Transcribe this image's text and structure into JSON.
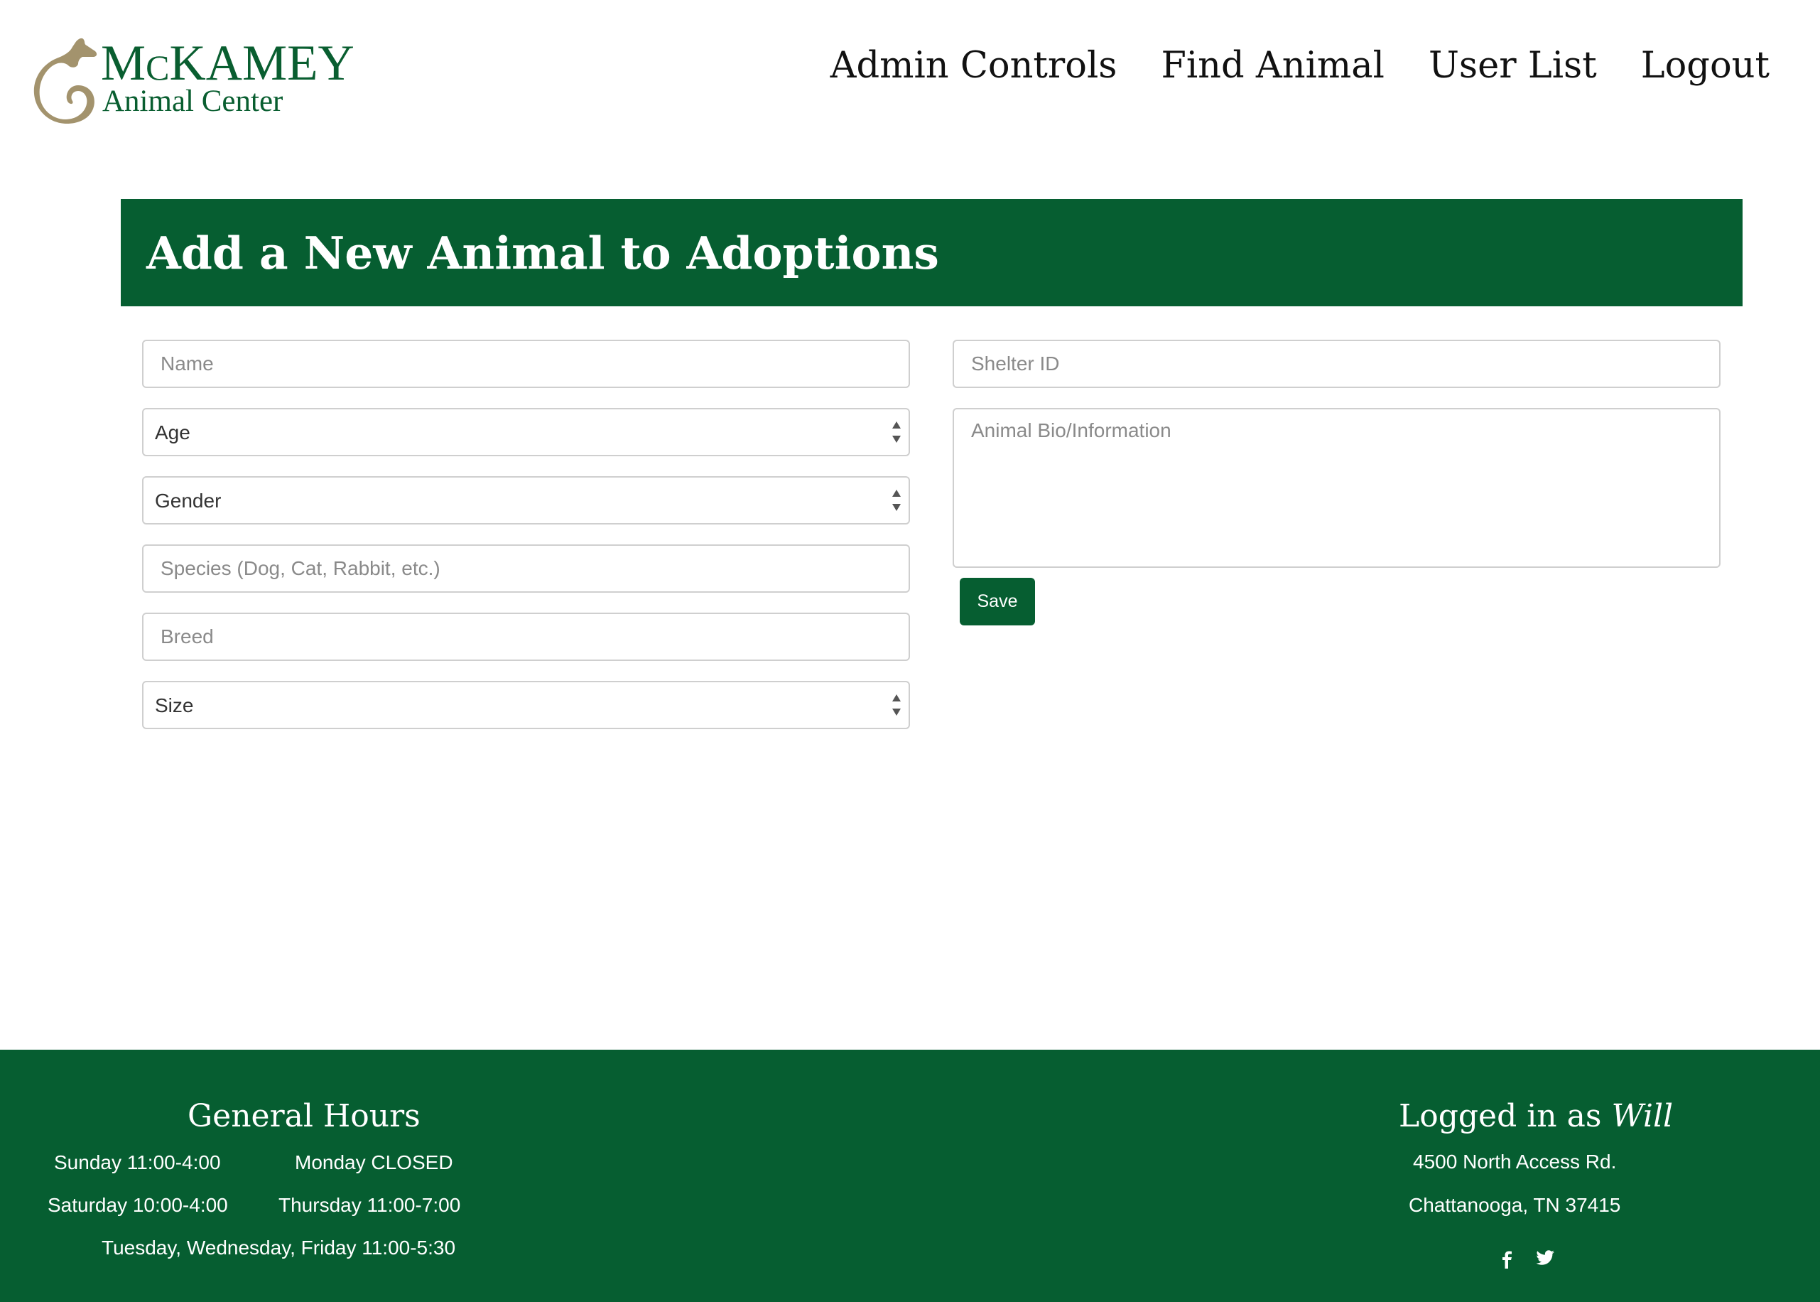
{
  "header": {
    "logo": {
      "title_initial": "M",
      "title_small": "c",
      "title_rest": "KAMEY",
      "subtitle": "Animal Center"
    },
    "nav": [
      {
        "label": "Admin Controls"
      },
      {
        "label": "Find Animal"
      },
      {
        "label": "User List"
      },
      {
        "label": "Logout"
      }
    ]
  },
  "page": {
    "title": "Add a New Animal to Adoptions"
  },
  "form": {
    "name": {
      "placeholder": "Name"
    },
    "age": {
      "selected": "Age"
    },
    "gender": {
      "selected": "Gender"
    },
    "species": {
      "placeholder": "Species (Dog, Cat, Rabbit, etc.)"
    },
    "breed": {
      "placeholder": "Breed"
    },
    "size": {
      "selected": "Size"
    },
    "shelter_id": {
      "placeholder": "Shelter ID"
    },
    "bio": {
      "placeholder": "Animal Bio/Information"
    },
    "save_label": "Save"
  },
  "footer": {
    "hours_title": "General Hours",
    "hours": {
      "sunday": "Sunday 11:00-4:00",
      "monday": "Monday CLOSED",
      "saturday": "Saturday 10:00-4:00",
      "thursday": "Thursday 11:00-7:00",
      "weekdays": "Tuesday, Wednesday, Friday 11:00-5:30"
    },
    "logged_in_prefix": "Logged in as",
    "logged_in_user": "Will",
    "address_line1": "4500 North Access Rd.",
    "address_line2": "Chattanooga, TN 37415",
    "social": [
      "facebook-icon",
      "twitter-icon"
    ]
  },
  "colors": {
    "brand_green": "#065e31",
    "logo_tan": "#a3936d"
  }
}
